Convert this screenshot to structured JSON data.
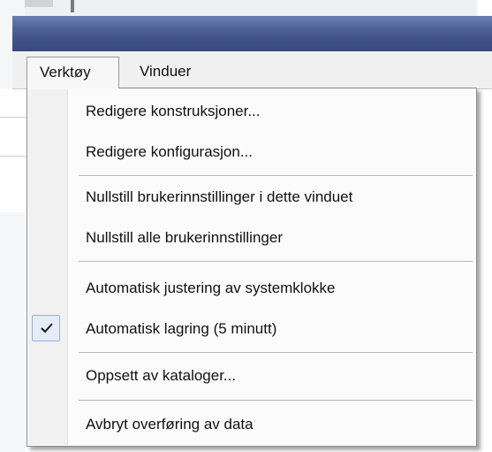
{
  "menubar": {
    "tabs": [
      {
        "label": "Verktøy",
        "active": true
      },
      {
        "label": "Vinduer",
        "active": false
      }
    ]
  },
  "dropdown": {
    "items": [
      {
        "label": "Redigere konstruksjoner...",
        "checked": false
      },
      {
        "label": "Redigere konfigurasjon...",
        "checked": false
      },
      {
        "label": "Nullstill brukerinnstillinger i dette vinduet",
        "checked": false
      },
      {
        "label": "Nullstill alle brukerinnstillinger",
        "checked": false
      },
      {
        "label": "Automatisk justering av systemklokke",
        "checked": false
      },
      {
        "label": "Automatisk lagring (5 minutt)",
        "checked": true
      },
      {
        "label": "Oppsett av kataloger...",
        "checked": false
      },
      {
        "label": "Avbryt overføring av data",
        "checked": false
      }
    ]
  },
  "colors": {
    "titlebar": "#3f5185",
    "menu_background": "#fbfbfb",
    "gutter": "#f1f1f1",
    "check_highlight": "#e3ecf7"
  },
  "icons": {
    "check": "checkmark-icon"
  }
}
